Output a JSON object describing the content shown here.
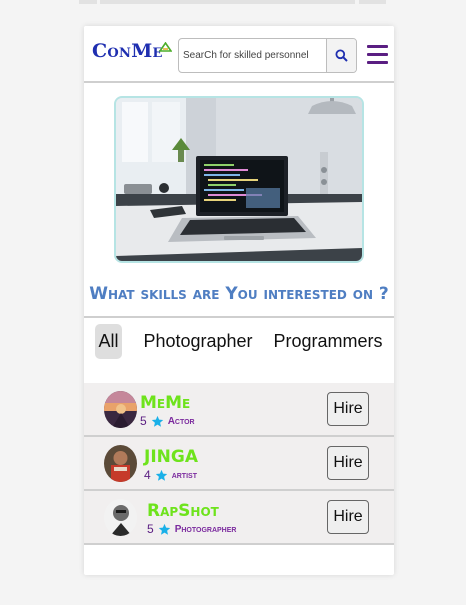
{
  "header": {
    "brand": "ConMe",
    "search": {
      "placeholder": "SearCh for skilled personnel",
      "value": ""
    }
  },
  "question": "What skills are You interested on ?",
  "tabs": [
    {
      "label": "All",
      "active": true
    },
    {
      "label": "Photographer",
      "active": false
    },
    {
      "label": "Programmers",
      "active": false
    }
  ],
  "people": [
    {
      "name": "MeMe",
      "rating": "5",
      "role": "Actor",
      "hire_label": "Hire"
    },
    {
      "name": "JINGA",
      "rating": "4",
      "role": "artist",
      "hire_label": "Hire"
    },
    {
      "name": "RapShot",
      "rating": "5",
      "role": "Photographer",
      "hire_label": "Hire"
    }
  ],
  "colors": {
    "brand": "#1f2fb0",
    "question": "#4f7ec2",
    "name": "#6ee31c",
    "role": "#7b2a9e",
    "star": "#1ab0e8",
    "menu": "#5a1e82"
  },
  "icons": {
    "search": "search-icon",
    "menu": "menu-icon",
    "star": "star-icon"
  }
}
